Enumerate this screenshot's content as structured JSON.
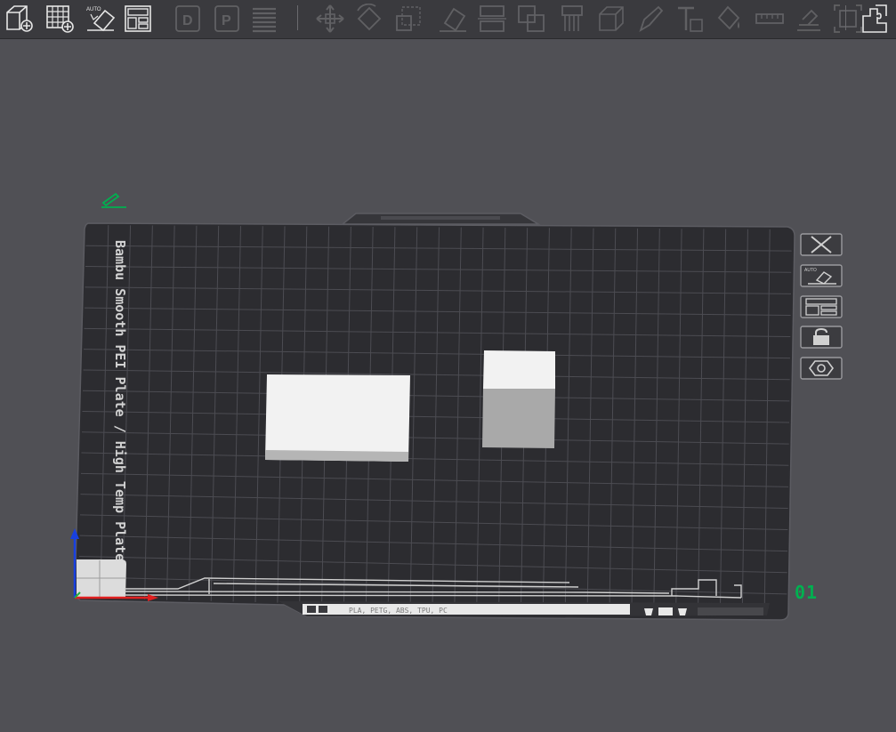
{
  "toolbar": {
    "left_tools": [
      {
        "name": "add-object-icon"
      },
      {
        "name": "add-plate-icon"
      },
      {
        "name": "auto-orient-icon",
        "label": "AUTO"
      },
      {
        "name": "arrange-icon"
      }
    ],
    "view_tools": [
      {
        "name": "front-view-icon",
        "label": "D"
      },
      {
        "name": "plate-view-icon",
        "label": "P"
      },
      {
        "name": "layers-icon"
      }
    ],
    "edit_tools": [
      {
        "name": "move-icon"
      },
      {
        "name": "rotate-icon"
      },
      {
        "name": "scale-icon"
      },
      {
        "name": "lay-on-face-icon"
      },
      {
        "name": "cut-icon"
      },
      {
        "name": "mesh-boolean-icon"
      },
      {
        "name": "support-paint-icon"
      },
      {
        "name": "seam-paint-icon"
      },
      {
        "name": "color-paint-icon"
      },
      {
        "name": "text-icon"
      },
      {
        "name": "fill-bucket-icon"
      },
      {
        "name": "measure-icon"
      },
      {
        "name": "assemble-icon"
      },
      {
        "name": "fit-view-icon"
      }
    ],
    "right_tool": {
      "name": "split-objects-icon"
    }
  },
  "plate": {
    "name": "Bambu Smooth PEI Plate / High Temp Plate",
    "filament_info": "PLA, PETG, ABS, TPU, PC",
    "number": "01",
    "side_buttons": [
      {
        "name": "close-plate-icon"
      },
      {
        "name": "auto-orient-plate-icon",
        "label": "AUTO"
      },
      {
        "name": "arrange-plate-icon"
      },
      {
        "name": "lock-plate-icon"
      },
      {
        "name": "plate-settings-icon"
      }
    ]
  },
  "colors": {
    "background": "#505055",
    "toolbar": "#3a3a3e",
    "plate": "#2c2c30",
    "accent_green": "#00b050",
    "axis_blue": "#1840e0",
    "axis_red": "#e02020"
  }
}
